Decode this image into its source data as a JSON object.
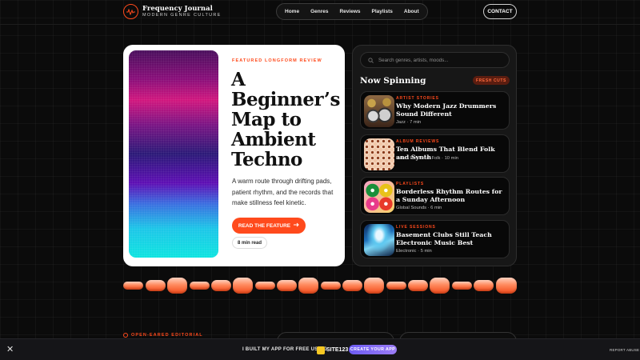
{
  "brand": {
    "title": "Frequency Journal",
    "subtitle": "MODERN GENRE CULTURE",
    "icon": "waveform-icon",
    "accent": "#ff4a1c"
  },
  "nav": {
    "items": [
      "Home",
      "Genres",
      "Reviews",
      "Playlists",
      "About"
    ],
    "contact": "CONTACT"
  },
  "hero": {
    "kicker": "FEATURED LONGFORM REVIEW",
    "title": "A Beginner’s Map to Ambient Techno",
    "description": "A warm route through drifting pads, patient rhythm, and the records that make stillness feel kinetic.",
    "cta": "READ THE FEATURE",
    "cta_icon": "arrow-right-icon",
    "read_time": "8 min read"
  },
  "sidebar": {
    "search_placeholder": "Search genres, artists, moods...",
    "heading": "Now Spinning",
    "badge": "FRESH CUTS",
    "cards": [
      {
        "kicker": "ARTIST STORIES",
        "title": "Why Modern Jazz Drummers Sound Different",
        "meta": "Jazz · 7 min",
        "thumb": "drum-kit-image"
      },
      {
        "kicker": "ALBUM REVIEWS",
        "title": "Ten Albums That Blend Folk and Synth",
        "meta": "Indie / Electronic Folk · 10 min",
        "thumb": "knobs-pattern-image"
      },
      {
        "kicker": "PLAYLISTS",
        "title": "Borderless Rhythm Routes for a Sunday Afternoon",
        "meta": "Global Sounds · 6 min",
        "thumb": "vinyl-records-image"
      },
      {
        "kicker": "LIVE SESSIONS",
        "title": "Basement Clubs Still Teach Electronic Music Best",
        "meta": "Electronic · 5 min",
        "thumb": "club-lights-image"
      }
    ]
  },
  "section": {
    "label": "OPEN-EARED EDITORIAL"
  },
  "promo": {
    "text": "I BUILT MY APP FOR FREE USING",
    "logo": "SITE123",
    "button": "CREATE YOUR APP",
    "report": "REPORT ABUSE",
    "close_icon": "close-icon"
  }
}
